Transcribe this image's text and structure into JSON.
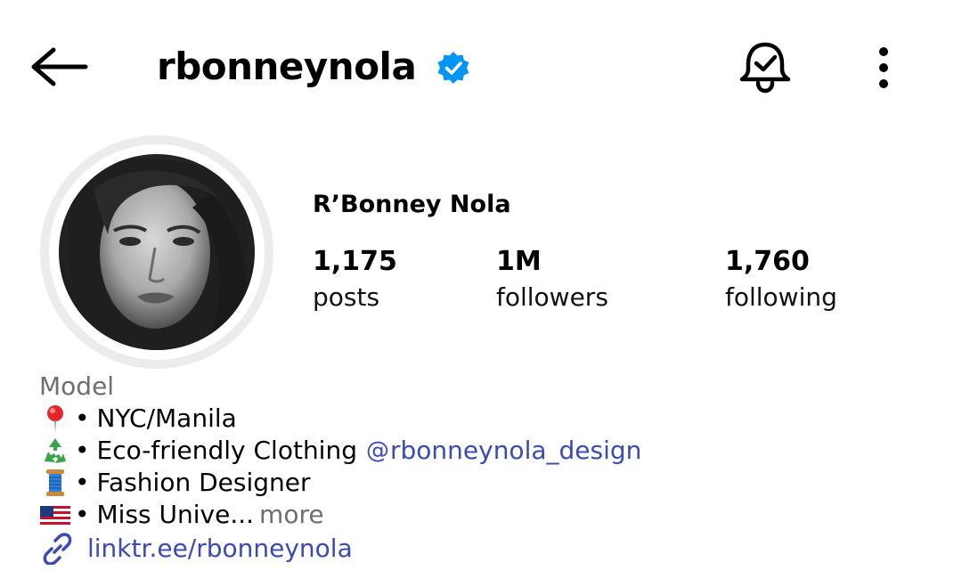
{
  "header": {
    "username": "rbonneynola"
  },
  "profile": {
    "display_name": "R’Bonney Nola",
    "stats": [
      {
        "value": "1,175",
        "label": "posts"
      },
      {
        "value": "1M",
        "label": "followers"
      },
      {
        "value": "1,760",
        "label": "following"
      }
    ]
  },
  "bio": {
    "category": "Model",
    "lines": [
      {
        "icon": "round-pushpin-icon",
        "bullet": "•",
        "text": "NYC/Manila"
      },
      {
        "icon": "recycle-icon",
        "bullet": "•",
        "text": "Eco-friendly Clothing",
        "mention": "rbonneynola_design"
      },
      {
        "icon": "spool-of-thread-icon",
        "bullet": "•",
        "text": "Fashion Designer"
      },
      {
        "icon": "us-flag-icon",
        "bullet": "•",
        "text": "Miss Unive...",
        "more": "more"
      }
    ],
    "link": "linktr.ee/rbonneynola"
  },
  "colors": {
    "link": "#3b4ab5",
    "verified": "#0095f6",
    "muted": "#6e6e6e"
  }
}
